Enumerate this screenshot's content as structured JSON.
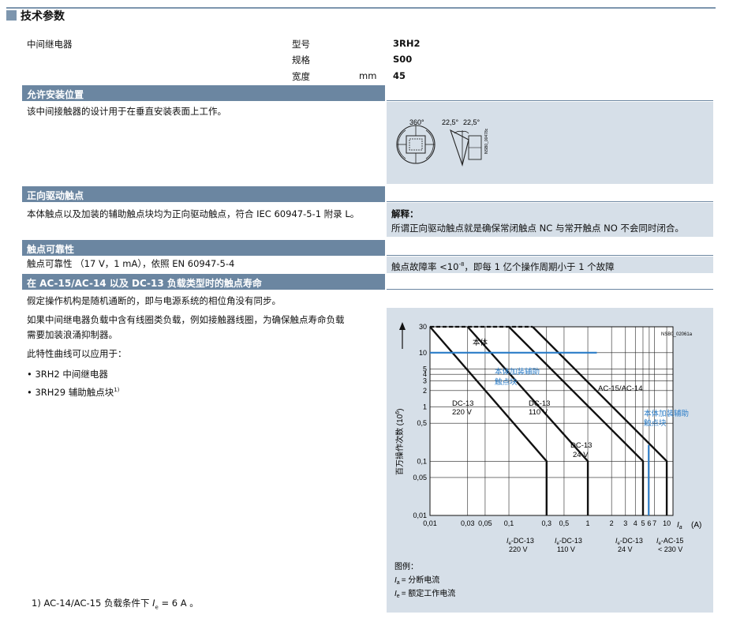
{
  "title": "技术参数",
  "spec": {
    "label": "中间继电器",
    "rows": [
      {
        "name": "型号",
        "unit": "",
        "value": "3RH2"
      },
      {
        "name": "规格",
        "unit": "",
        "value": "S00"
      },
      {
        "name": "宽度",
        "unit": "mm",
        "value": "45"
      }
    ]
  },
  "mounting": {
    "heading": "允许安装位置",
    "text": "该中间接触器的设计用于在垂直安装表面上工作。",
    "diagram": {
      "angle1": "360°",
      "angle2": "22,5°",
      "angle3": "22,5°",
      "code": "NSB0_00478c"
    }
  },
  "positive": {
    "heading": "正向驱动触点",
    "text": "本体触点以及加装的辅助触点块均为正向驱动触点，符合 IEC 60947-5-1 附录 L。",
    "note_title": "解释：",
    "note_text": "所谓正向驱动触点就是确保常闭触点 NC 与常开触点 NO 不会同时闭合。"
  },
  "reliability": {
    "heading": "触点可靠性",
    "text": "触点可靠性 （17 V，1 mA），依照 EN 60947-5-4",
    "value_pre": "触点故障率 <10",
    "value_exp": "-8",
    "value_post": "，即每 1 亿个操作周期小于 1 个故障"
  },
  "life": {
    "heading": "在 AC-15/AC-14 以及 DC-13 负载类型时的触点寿命",
    "p1": "假定操作机构是随机通断的，即与电源系统的相位角没有同步。",
    "p2a": "如果中间继电器负载中含有线圈类负载，例如接触器线圈，为确保触点寿命负载",
    "p2b": "需要加装浪涌抑制器。",
    "p3": "此特性曲线可以应用于：",
    "bullets": [
      "3RH2 中间继电器",
      "3RH29 辅助触点块"
    ],
    "bullet2_sup": "1)",
    "footnote_pre": "1)  AC-14/AC-15 负载条件下 ",
    "footnote_i": "I",
    "footnote_sub": "e",
    "footnote_post": " = 6 A 。"
  },
  "chart_data": {
    "type": "line",
    "code": "NSB0_02061a",
    "xscale": "log",
    "yscale": "log",
    "xlim": [
      0.01,
      12
    ],
    "ylim": [
      0.01,
      30
    ],
    "x_ticks": [
      "0,01",
      "0,03",
      "0,05",
      "0,1",
      "0,3",
      "0,5",
      "1",
      "2",
      "3",
      "4",
      "5",
      "6",
      "7",
      "10"
    ],
    "y_ticks": [
      "30",
      "10",
      "5",
      "4",
      "3",
      "2",
      "1",
      "0,5",
      "0,1",
      "0,05",
      "0,01"
    ],
    "x_values": [
      0.01,
      0.03,
      0.05,
      0.1,
      0.3,
      0.5,
      1,
      2,
      3,
      4,
      5,
      6,
      7,
      10
    ],
    "y_values": [
      30,
      10,
      5,
      4,
      3,
      2,
      1,
      0.5,
      0.1,
      0.05,
      0.01
    ],
    "xlabel_i": "I",
    "xlabel_sub": "a",
    "xlabel_unit": "(A)",
    "ylabel": "百万操作次数 (10",
    "ylabel_sup": "6",
    "ylabel_close": ")",
    "series": [
      {
        "name": "DC-13 220 V",
        "points": [
          [
            0.01,
            30
          ],
          [
            0.3,
            0.1
          ],
          [
            0.3,
            0.01
          ]
        ]
      },
      {
        "name": "DC-13 110 V",
        "points": [
          [
            0.03,
            30
          ],
          [
            1,
            0.1
          ],
          [
            1,
            0.01
          ]
        ]
      },
      {
        "name": "DC-13 24 V",
        "points": [
          [
            0.1,
            30
          ],
          [
            5,
            0.1
          ],
          [
            5,
            0.01
          ]
        ]
      },
      {
        "name": "AC-15/AC-14",
        "points": [
          [
            0.2,
            30
          ],
          [
            10,
            0.1
          ],
          [
            10,
            0.01
          ]
        ]
      }
    ],
    "labels": {
      "body": "本体",
      "aux1a": "本体加装辅助",
      "aux1b": "触点块",
      "ac": "AC-15/AC-14",
      "dc220a": "DC-13",
      "dc220b": "220 V",
      "dc110a": "DC-13",
      "dc110b": "110 V",
      "dc24a": "DC-13",
      "dc24b": "24 V",
      "aux2a": "本体加装辅助",
      "aux2b": "触点块"
    },
    "bottom_labels": [
      {
        "l1": "-DC-13",
        "l2": "220 V"
      },
      {
        "l1": "-DC-13",
        "l2": "110 V"
      },
      {
        "l1": "-DC-13",
        "l2": "24 V"
      },
      {
        "l1": "-AC-15",
        "l2": "< 230 V"
      }
    ],
    "blue": "#2a7cc7",
    "legend_title": "图例：",
    "legend1": "= 分断电流",
    "legend2": "= 额定工作电流"
  },
  "colors": {
    "header": "#6b86a1",
    "panel": "#d6dfe8"
  }
}
